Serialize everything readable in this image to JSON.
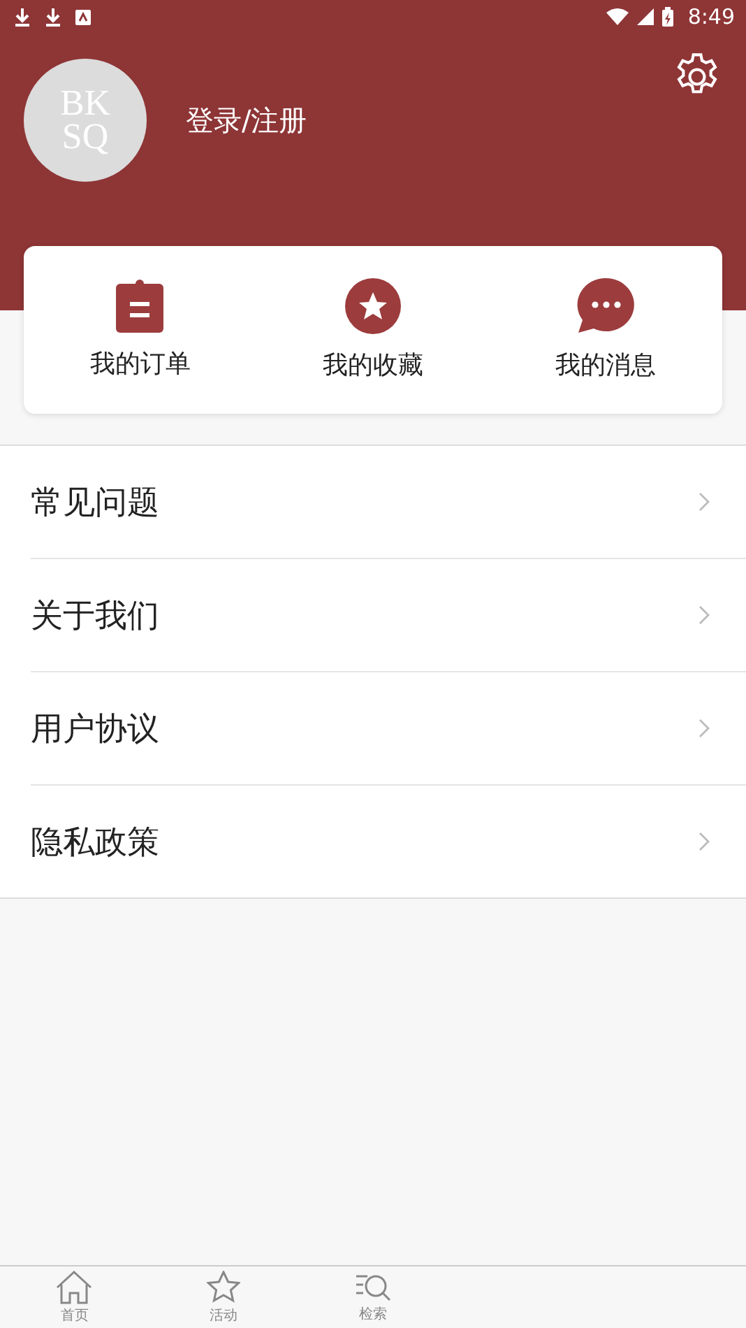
{
  "status_bar": {
    "time": "8:49"
  },
  "profile": {
    "avatar_top": "BK",
    "avatar_bottom": "SQ",
    "login_label": "登录/注册"
  },
  "shortcuts": [
    {
      "kind": "order",
      "label": "我的订单"
    },
    {
      "kind": "favorite",
      "label": "我的收藏"
    },
    {
      "kind": "message",
      "label": "我的消息"
    }
  ],
  "menu": [
    {
      "label": "常见问题"
    },
    {
      "label": "关于我们"
    },
    {
      "label": "用户协议"
    },
    {
      "label": "隐私政策"
    }
  ],
  "bottom_nav": [
    {
      "kind": "home",
      "label": "首页",
      "selected": false
    },
    {
      "kind": "activity",
      "label": "活动",
      "selected": false
    },
    {
      "kind": "search",
      "label": "检索",
      "selected": false
    }
  ]
}
